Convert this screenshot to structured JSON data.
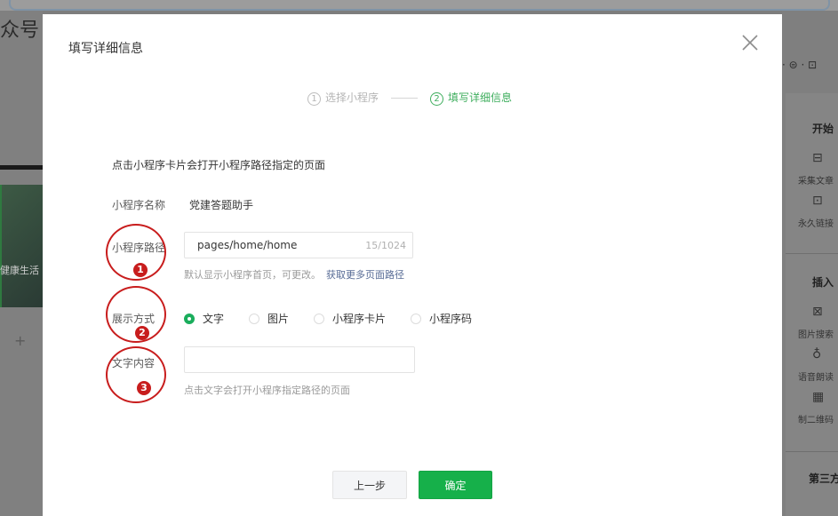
{
  "background": {
    "left_title": "众号",
    "left_thumb_text": "健康生活",
    "left_add": "+",
    "right_tools": "· ⊜ · ⊡",
    "right_sections": [
      {
        "label": "开始",
        "items": [
          "采集文章",
          "永久链接"
        ]
      },
      {
        "label": "插入",
        "items": [
          "图片搜索",
          "语音朗读",
          "制二维码"
        ]
      },
      {
        "label": "第三方",
        "items": []
      }
    ]
  },
  "dialog": {
    "title": "填写详细信息",
    "steps": [
      {
        "num": "1",
        "label": "选择小程序",
        "state": "done"
      },
      {
        "num": "2",
        "label": "填写详细信息",
        "state": "active"
      }
    ],
    "hint": "点击小程序卡片会打开小程序路径指定的页面",
    "name_label": "小程序名称",
    "name_value": "党建答题助手",
    "path_label": "小程序路径",
    "path_value": "pages/home/home",
    "path_count": "15/1024",
    "path_tip": "默认显示小程序首页，可更改。",
    "path_link": "获取更多页面路径",
    "display_label": "展示方式",
    "display_options": [
      {
        "label": "文字",
        "selected": true
      },
      {
        "label": "图片",
        "selected": false
      },
      {
        "label": "小程序卡片",
        "selected": false
      },
      {
        "label": "小程序码",
        "selected": false
      }
    ],
    "text_label": "文字内容",
    "text_value": "",
    "text_tip": "点击文字会打开小程序指定路径的页面",
    "prev_button": "上一步",
    "ok_button": "确定"
  },
  "annotations": [
    "1",
    "2",
    "3"
  ],
  "colors": {
    "accent": "#16b04a",
    "link": "#576b95",
    "annotation": "#c81d1d",
    "overlay": "#7d7d7d"
  }
}
